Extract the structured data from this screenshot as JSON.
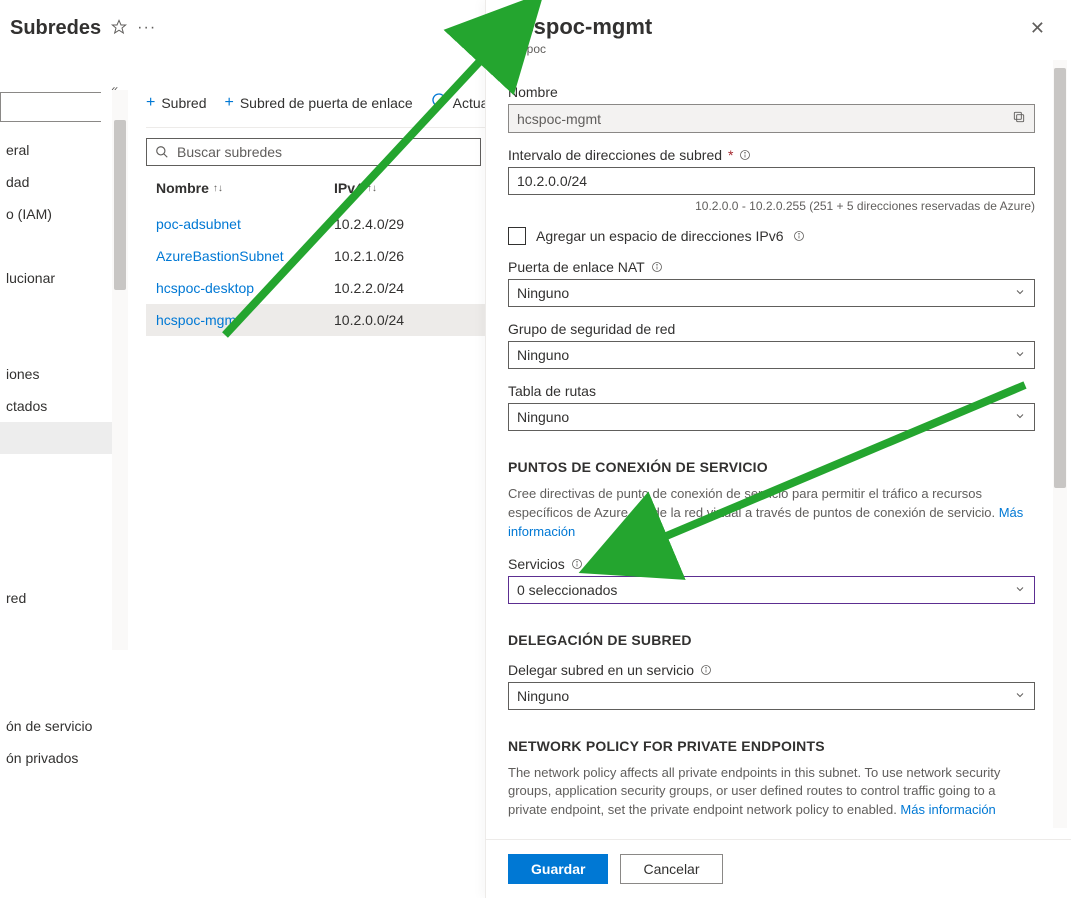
{
  "page": {
    "title": "Subredes"
  },
  "nav": {
    "search_placeholder": "",
    "items": [
      {
        "label": "eral"
      },
      {
        "label": "dad"
      },
      {
        "label": "o (IAM)"
      },
      {
        "label": ""
      },
      {
        "label": "lucionar"
      },
      {
        "label": ""
      },
      {
        "label": ""
      },
      {
        "label": "iones"
      },
      {
        "label": "ctados"
      },
      {
        "label": "",
        "selected": true
      },
      {
        "label": ""
      },
      {
        "label": ""
      },
      {
        "label": ""
      },
      {
        "label": ""
      },
      {
        "label": " red"
      },
      {
        "label": ""
      },
      {
        "label": ""
      },
      {
        "label": ""
      },
      {
        "label": "ón de servicio"
      },
      {
        "label": "ón privados"
      }
    ]
  },
  "toolbar": {
    "add_subnet": "Subred",
    "add_gateway_subnet": "Subred de puerta de enlace",
    "refresh": "Actua"
  },
  "list": {
    "search_placeholder": "Buscar subredes",
    "columns": {
      "name": "Nombre",
      "ipv4": "IPv4"
    },
    "rows": [
      {
        "name": "poc-adsubnet",
        "ipv4": "10.2.4.0/29",
        "selected": false
      },
      {
        "name": "AzureBastionSubnet",
        "ipv4": "10.2.1.0/26",
        "selected": false
      },
      {
        "name": "hcspoc-desktop",
        "ipv4": "10.2.2.0/24",
        "selected": false
      },
      {
        "name": "hcspoc-mgmt",
        "ipv4": "10.2.0.0/24",
        "selected": true
      }
    ]
  },
  "panel": {
    "title": "hcspoc-mgmt",
    "subtitle": "hcspoc",
    "name_label": "Nombre",
    "name_value": "hcspoc-mgmt",
    "range_label": "Intervalo de direcciones de subred",
    "range_value": "10.2.0.0/24",
    "range_helper": "10.2.0.0 - 10.2.0.255 (251 + 5 direcciones reservadas de Azure)",
    "ipv6_checkbox": "Agregar un espacio de direcciones IPv6",
    "nat_label": "Puerta de enlace NAT",
    "nat_value": "Ninguno",
    "nsg_label": "Grupo de seguridad de red",
    "nsg_value": "Ninguno",
    "rt_label": "Tabla de rutas",
    "rt_value": "Ninguno",
    "svc_heading": "PUNTOS DE CONEXIÓN DE SERVICIO",
    "svc_paragraph": "Cree directivas de punto de conexión de servicio para permitir el tráfico a recursos específicos de Azure desde la red virtual a través de puntos de conexión de servicio. ",
    "svc_link": "Más información",
    "services_label": "Servicios",
    "services_value": "0 seleccionados",
    "deleg_heading": "DELEGACIÓN DE SUBRED",
    "deleg_label": "Delegar subred en un servicio",
    "deleg_value": "Ninguno",
    "np_heading": "NETWORK POLICY FOR PRIVATE ENDPOINTS",
    "np_paragraph": "The network policy affects all private endpoints in this subnet. To use network security groups, application security groups, or user defined routes to control traffic going to a private endpoint, set the private endpoint network policy to enabled. ",
    "np_link": "Más información",
    "save": "Guardar",
    "cancel": "Cancelar"
  }
}
